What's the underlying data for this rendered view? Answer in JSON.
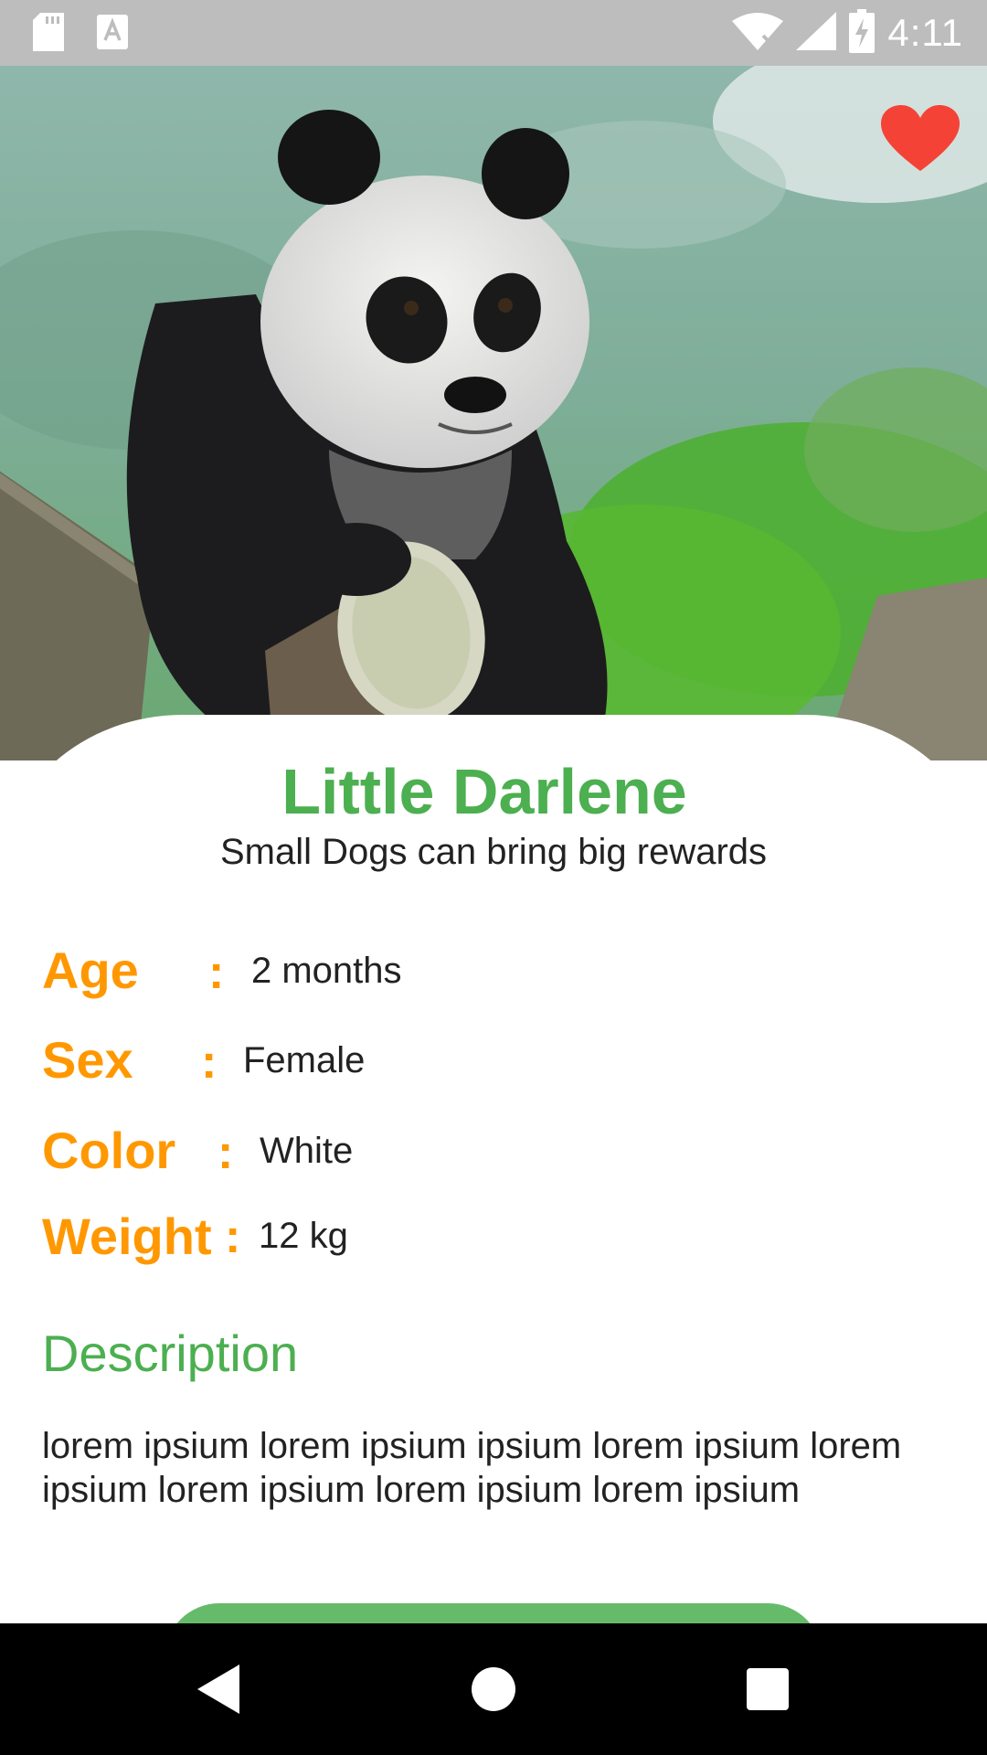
{
  "status_bar": {
    "time": "4:11",
    "icons": [
      "sd-card-icon",
      "font-a-icon",
      "wifi-off-icon",
      "signal-icon",
      "battery-charging-icon"
    ]
  },
  "hero": {
    "image_subject": "giant panda on a tree branch",
    "favorite_icon": "heart-icon",
    "favorite_color": "#f44336"
  },
  "pet": {
    "name": "Little Darlene",
    "tagline": "Small Dogs can bring big rewards"
  },
  "attributes": [
    {
      "label": "Age",
      "value": "2 months"
    },
    {
      "label": "Sex",
      "value": "Female"
    },
    {
      "label": "Color",
      "value": "White"
    },
    {
      "label": "Weight",
      "value": "12 kg"
    }
  ],
  "separator": ":",
  "description": {
    "title": "Description",
    "text": "lorem ipsium lorem ipsium ipsium lorem ipsium lorem ipsium lorem ipsium lorem ipsium lorem ipsium"
  },
  "colors": {
    "primary_green": "#4caf50",
    "accent_orange": "#ff9800",
    "button_green": "#66bb6a"
  },
  "nav_bar": {
    "icons": [
      "back-icon",
      "home-icon",
      "recents-icon"
    ]
  }
}
